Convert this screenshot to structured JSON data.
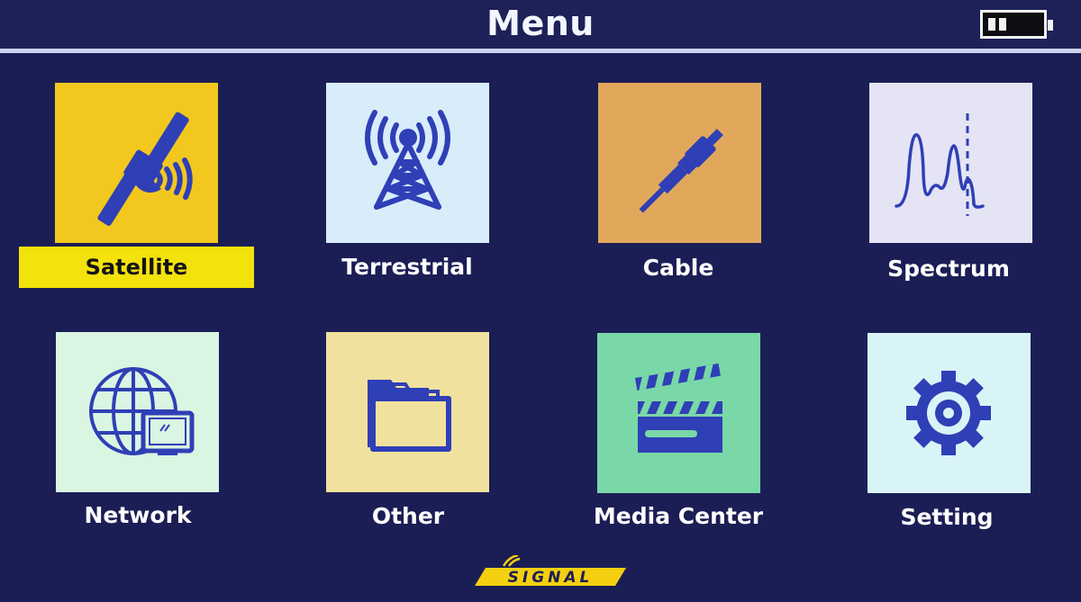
{
  "header": {
    "title": "Menu",
    "battery_icon": "battery-icon"
  },
  "menu_items": [
    {
      "label": "Satellite",
      "icon": "satellite-icon",
      "tile_color": "#f2c81e",
      "selected": true
    },
    {
      "label": "Terrestrial",
      "icon": "antenna-tower-icon",
      "tile_color": "#d8ecfa",
      "selected": false
    },
    {
      "label": "Cable",
      "icon": "coax-cable-icon",
      "tile_color": "#e1a85c",
      "selected": false
    },
    {
      "label": "Spectrum",
      "icon": "spectrum-icon",
      "tile_color": "#e4e4f4",
      "selected": false
    },
    {
      "label": "Network",
      "icon": "globe-network-icon",
      "tile_color": "#daf5e2",
      "selected": false
    },
    {
      "label": "Other",
      "icon": "folder-icon",
      "tile_color": "#f1e19e",
      "selected": false
    },
    {
      "label": "Media Center",
      "icon": "clapperboard-icon",
      "tile_color": "#7ad8a8",
      "selected": false
    },
    {
      "label": "Setting",
      "icon": "gear-icon",
      "tile_color": "#d9f4f6",
      "selected": false
    }
  ],
  "colors": {
    "background": "#1b1e55",
    "icon": "#2f3fb6",
    "selection_highlight": "#f4e20c"
  },
  "branding": {
    "logo": "SIGNAL"
  }
}
